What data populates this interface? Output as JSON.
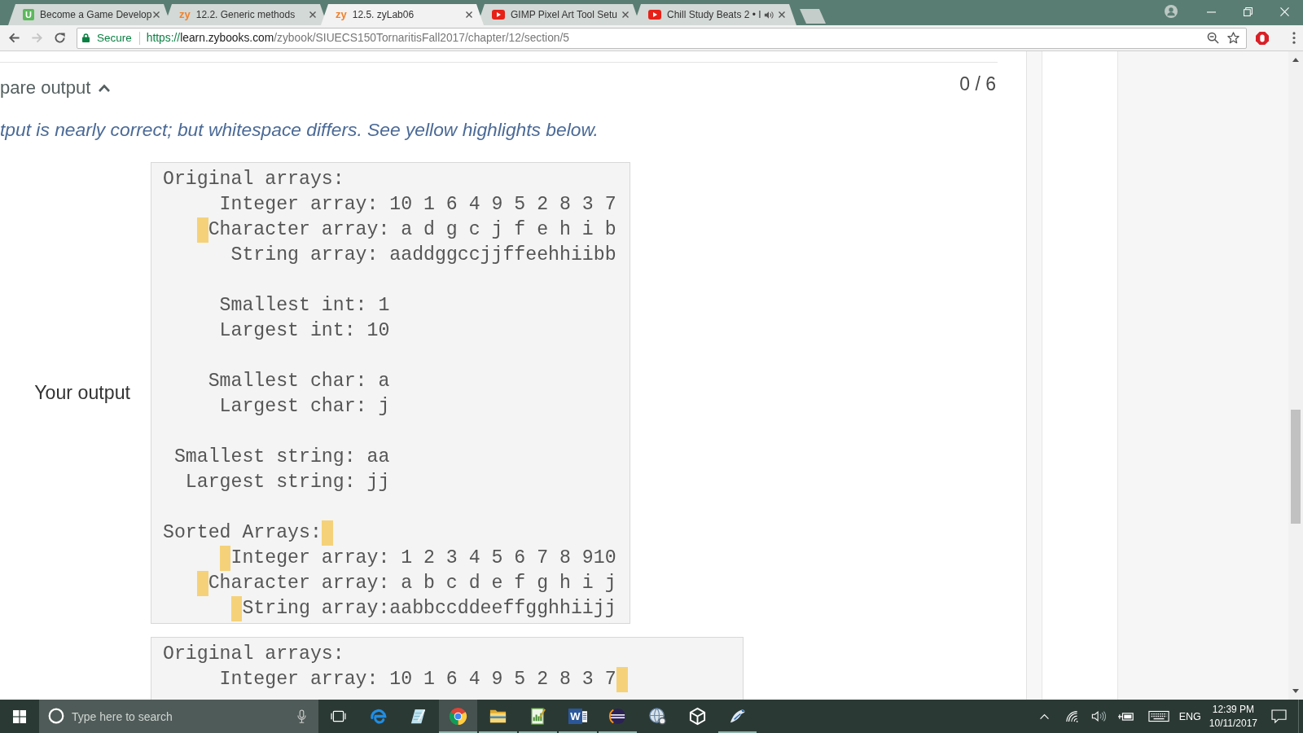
{
  "browser": {
    "tabs": [
      {
        "kind": "letter_logo",
        "logo_text": "U",
        "title": "Become a Game Develop",
        "audio": false,
        "selected": false
      },
      {
        "kind": "zy_logo",
        "logo_text": "zy",
        "title": "12.2. Generic methods",
        "audio": false,
        "selected": false
      },
      {
        "kind": "zy_logo",
        "logo_text": "zy",
        "title": "12.5. zyLab06",
        "audio": false,
        "selected": true
      },
      {
        "kind": "video_logo",
        "title": "GIMP Pixel Art Tool Setu",
        "audio": false,
        "selected": false
      },
      {
        "kind": "video_logo",
        "title": "Chill Study Beats 2 • I",
        "audio": true,
        "selected": false
      }
    ],
    "back_enabled": true,
    "forward_enabled": false,
    "security_label": "Secure",
    "url": {
      "scheme": "https://",
      "host": "learn.zybooks.com",
      "path": "/zybook/SIUECS150TornaritisFall2017/chapter/12/section/5"
    }
  },
  "lab": {
    "section_title": "pare output",
    "expanded": true,
    "score": "0 / 6",
    "message": "tput is nearly correct; but whitespace differs. See yellow highlights below.",
    "outputs": [
      {
        "label": "Your output",
        "blocks": [
          {
            "lines": [
              {
                "text": "Original arrays:",
                "highlight_before": false,
                "highlight_after": false
              },
              {
                "text": "     Integer array: 10 1 6 4 9 5 2 8 3 7",
                "highlight_before": false,
                "highlight_after": false
              },
              {
                "text": "   Character array: a d g c j f e h i b",
                "highlight_before": true,
                "highlight_after": false
              },
              {
                "text": "      String array: aaddggccjjffeehhiibb",
                "highlight_before": false,
                "highlight_after": false
              }
            ]
          },
          {
            "lines": [
              {
                "text": "     Smallest int: 1",
                "highlight_before": false,
                "highlight_after": false
              },
              {
                "text": "     Largest int: 10",
                "highlight_before": false,
                "highlight_after": false
              }
            ]
          },
          {
            "lines": [
              {
                "text": "    Smallest char: a",
                "highlight_before": false,
                "highlight_after": false
              },
              {
                "text": "     Largest char: j",
                "highlight_before": false,
                "highlight_after": false
              }
            ]
          },
          {
            "lines": [
              {
                "text": " Smallest string: aa",
                "highlight_before": false,
                "highlight_after": false
              },
              {
                "text": "  Largest string: jj",
                "highlight_before": false,
                "highlight_after": false
              }
            ]
          },
          {
            "lines": [
              {
                "text": "Sorted Arrays:",
                "highlight_before": false,
                "highlight_after": true
              },
              {
                "text": "     Integer array: 1 2 3 4 5 6 7 8 910",
                "highlight_before": true,
                "highlight_after": false
              },
              {
                "text": "   Character array: a b c d e f g h i j",
                "highlight_before": true,
                "highlight_after": false
              },
              {
                "text": "      String array:aabbccddeeffgghhiijj",
                "highlight_before": true,
                "highlight_after": false
              }
            ]
          }
        ]
      },
      {
        "blocks": [
          {
            "lines": [
              {
                "text": "Original arrays:",
                "highlight_before": false,
                "highlight_after": false
              },
              {
                "text": "     Integer array: 10 1 6 4 9 5 2 8 3 7",
                "highlight_before": false,
                "highlight_after": true
              }
            ]
          }
        ]
      }
    ]
  },
  "taskbar": {
    "search_placeholder": "Type here to search",
    "apps": [
      {
        "kind": "edge",
        "running": false,
        "active": false
      },
      {
        "kind": "notes",
        "running": false,
        "active": false
      },
      {
        "kind": "chrome",
        "running": true,
        "active": true
      },
      {
        "kind": "folder",
        "running": true,
        "active": false
      },
      {
        "kind": "chart_doc",
        "running": true,
        "active": false
      },
      {
        "kind": "word",
        "label": "W",
        "running": true,
        "active": false
      },
      {
        "kind": "eclipse",
        "running": true,
        "active": false
      },
      {
        "kind": "globe",
        "running": false,
        "active": false
      },
      {
        "kind": "unity",
        "running": false,
        "active": false
      },
      {
        "kind": "bird",
        "running": true,
        "active": false
      }
    ],
    "language": "ENG",
    "time": "12:39 PM",
    "date": "10/11/2017"
  }
}
